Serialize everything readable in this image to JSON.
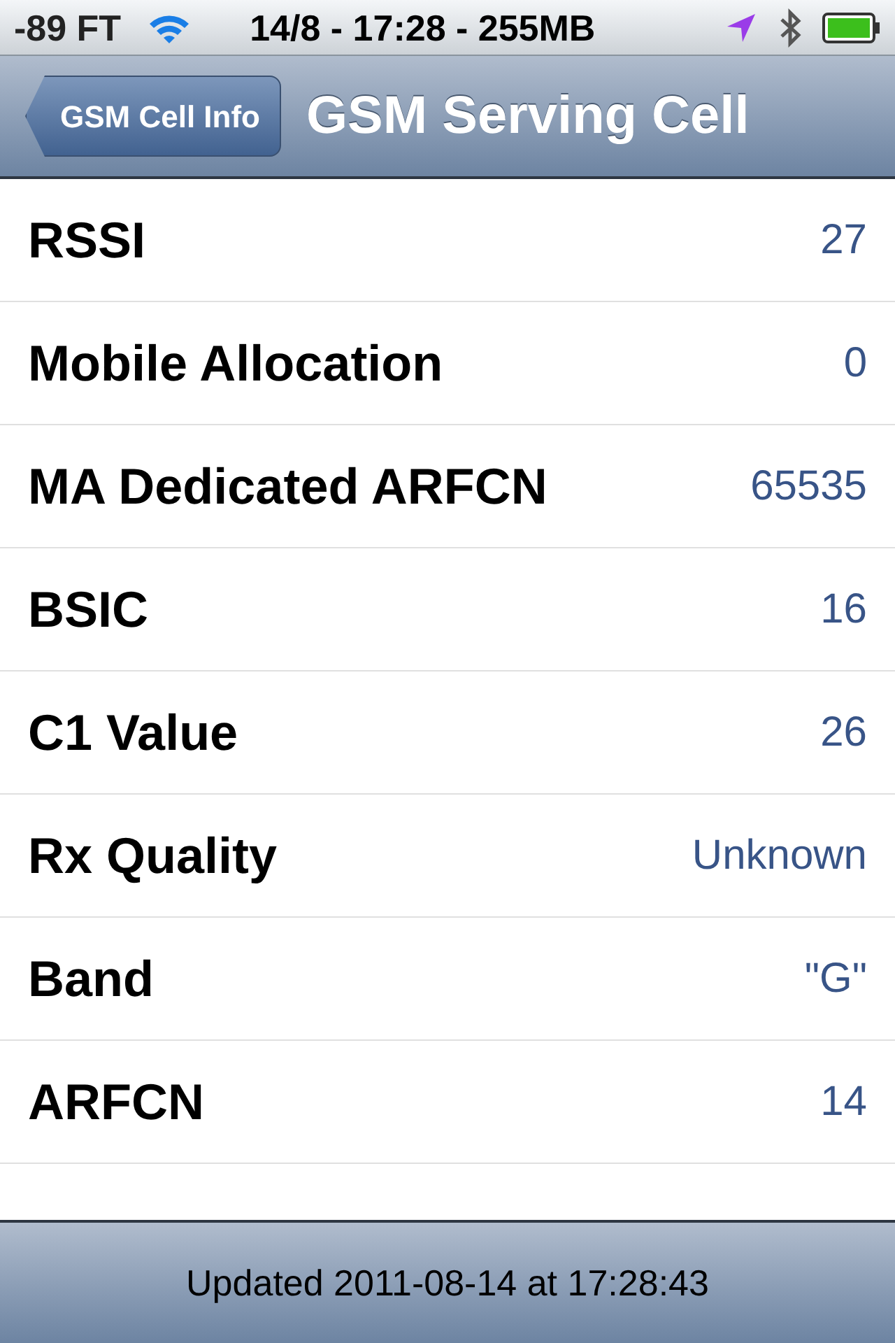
{
  "status_bar": {
    "carrier": "-89 FT",
    "center": "14/8 - 17:28 - 255MB"
  },
  "nav_bar": {
    "back_button": "GSM Cell Info",
    "title": "GSM Serving Cell"
  },
  "rows": [
    {
      "label": "RSSI",
      "value": "27"
    },
    {
      "label": "Mobile Allocation",
      "value": "0"
    },
    {
      "label": "MA Dedicated ARFCN",
      "value": "65535"
    },
    {
      "label": "BSIC",
      "value": "16"
    },
    {
      "label": "C1 Value",
      "value": "26"
    },
    {
      "label": "Rx Quality",
      "value": "Unknown"
    },
    {
      "label": "Band",
      "value": "\"G\""
    },
    {
      "label": "ARFCN",
      "value": "14"
    }
  ],
  "toolbar": {
    "text": "Updated 2011-08-14 at 17:28:43"
  }
}
